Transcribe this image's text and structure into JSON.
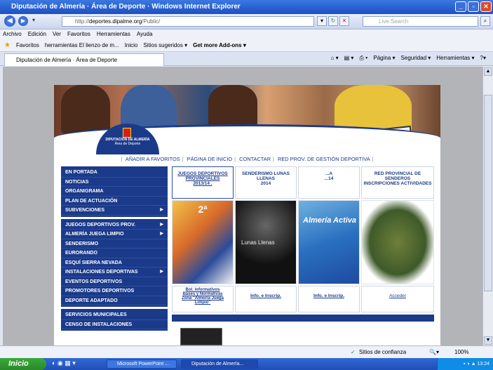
{
  "window": {
    "title": "Diputación de Almería · Área de Deporte · Windows Internet Explorer"
  },
  "address": {
    "prefix": "http://",
    "host": "deportes.dipalme.org",
    "path": "/Public/"
  },
  "search": {
    "placeholder": "Live Search"
  },
  "menu": [
    "Archivo",
    "Edición",
    "Ver",
    "Favoritos",
    "Herramientas",
    "Ayuda"
  ],
  "favorites": {
    "label": "Favoritos",
    "items": [
      "herramientas El lienzo de m...",
      "Inicio",
      "Sitios sugeridos ▾",
      "Get more Add-ons ▾"
    ]
  },
  "tab": {
    "label": "Diputación de Almería · Área de Deporte"
  },
  "commandbar": [
    "Página ▾",
    "Seguridad ▾",
    "Herramientas ▾"
  ],
  "banner": {
    "logo_title": "DIPUTACIÓN DE ALMERÍA",
    "logo_sub": "Área de Deporte",
    "bib": "077"
  },
  "topnav": [
    "AÑADIR A FAVORITOS",
    "PÁGINA DE INICIO",
    "CONTACTAR",
    "RED PROV. DE GESTIÓN DEPORTIVA"
  ],
  "nav_groups": [
    {
      "items": [
        {
          "label": "EN PORTADA"
        },
        {
          "label": "NOTICIAS"
        },
        {
          "label": "ORGANIGRAMA"
        },
        {
          "label": "PLAN DE ACTUACIÓN"
        },
        {
          "label": "SUBVENCIONES",
          "arrow": true
        }
      ]
    },
    {
      "items": [
        {
          "label": "JUEGOS DEPORTIVOS PROV.",
          "arrow": true
        },
        {
          "label": "ALMERÍA JUEGA LIMPIO",
          "arrow": true
        },
        {
          "label": "SENDERISMO"
        },
        {
          "label": "EURORANDO"
        },
        {
          "label": "ESQUÍ SIERRA NEVADA"
        },
        {
          "label": "INSTALACIONES DEPORTIVAS",
          "arrow": true
        },
        {
          "label": "EVENTOS DEPORTIVOS"
        },
        {
          "label": "PROMOTORES DEPORTIVOS"
        },
        {
          "label": "DEPORTE ADAPTADO"
        }
      ]
    },
    {
      "items": [
        {
          "label": "SERVICIOS MUNICIPALES"
        },
        {
          "label": "CENSO DE INSTALACIONES"
        }
      ]
    }
  ],
  "cards": [
    {
      "title_1": "JUEGOS DEPORTIVOS",
      "title_2": "PROVINCIALES",
      "title_3": "2013/14 ."
    },
    {
      "title_1": "SENDERISMO LUNAS",
      "title_2": "LLENAS",
      "title_3": "2014"
    },
    {
      "title_1": "...A",
      "title_2": "",
      "title_3": "...14"
    },
    {
      "title_1": "RED PROVINCIAL DE",
      "title_2": "SENDEROS",
      "title_3": "INSCRIPCIONES ACTIVIDADES"
    }
  ],
  "images": [
    {
      "alt": "Cartel Juegos Deportivos",
      "text": "2ª"
    },
    {
      "alt": "Cartel Lunas Llenas",
      "text": "Lunas Llenas"
    },
    {
      "alt": "Cartel Almería Activa",
      "text": "Almería Activa"
    },
    {
      "alt": "Mapa red de senderos",
      "text": ""
    }
  ],
  "links": [
    {
      "l1": "Bol. informativos",
      "l2": "Bases y Normativas",
      "l3": "Zona \"Almería Juega",
      "l4": "Limpio\""
    },
    {
      "l1": "Info. e Inscrip."
    },
    {
      "l1": "Info. e Inscrip."
    },
    {
      "l1": "Acceder"
    }
  ],
  "status": {
    "zone": "Sitios de confianza",
    "zoom": "100%"
  },
  "taskbar": {
    "start": "Inicio",
    "tasks": [
      "Microsoft PowerPoint ...",
      "Diputación de Almería..."
    ],
    "time": "13:24"
  }
}
